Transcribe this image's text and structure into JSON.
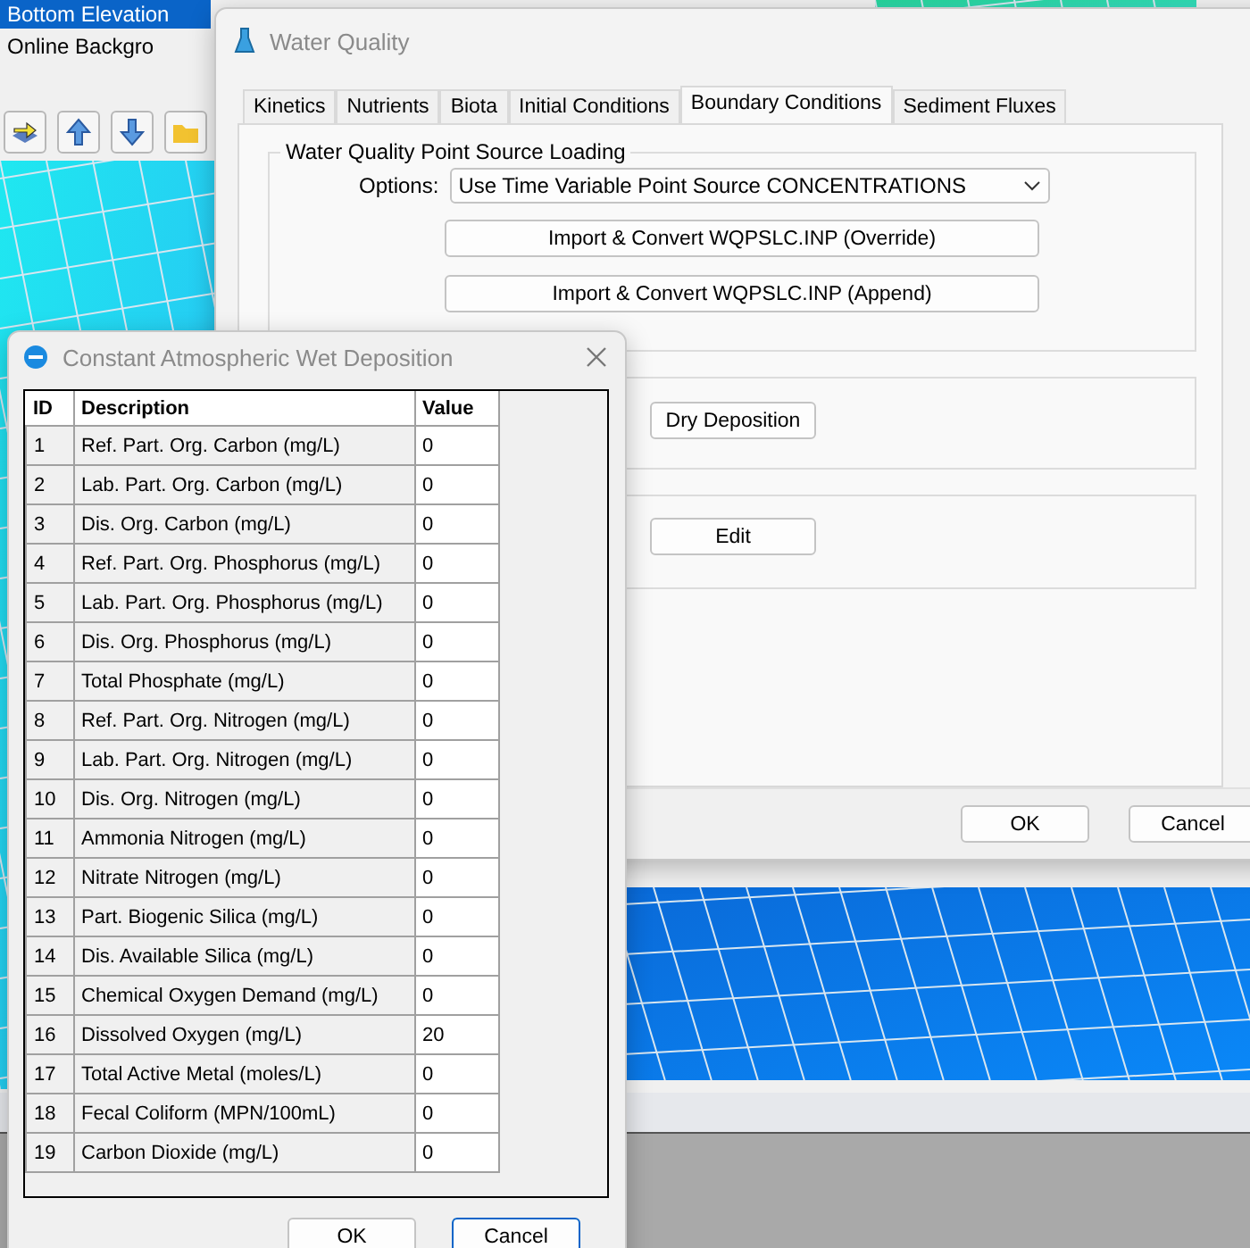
{
  "background_app": {
    "layers": [
      {
        "label": "Bottom Elevation",
        "selected": true
      },
      {
        "label": "Online Backgro",
        "selected": false
      }
    ]
  },
  "water_quality": {
    "title": "Water Quality",
    "tabs": [
      {
        "label": "Kinetics",
        "selected": false
      },
      {
        "label": "Nutrients",
        "selected": false
      },
      {
        "label": "Biota",
        "selected": false
      },
      {
        "label": "Initial Conditions",
        "selected": false
      },
      {
        "label": "Boundary Conditions",
        "selected": true
      },
      {
        "label": "Sediment Fluxes",
        "selected": false
      }
    ],
    "point_source": {
      "legend": "Water Quality Point Source Loading",
      "options_label": "Options:",
      "option_value": "Use Time Variable Point Source CONCENTRATIONS",
      "buttons": [
        "Import & Convert WQPSLC.INP (Override)",
        "Import & Convert WQPSLC.INP (Append)"
      ]
    },
    "dry_deposition_button": "Dry Deposition",
    "edit_button": "Edit",
    "buttons": [
      {
        "label": "OK",
        "focused": false
      },
      {
        "label": "Cancel",
        "focused": false
      }
    ]
  },
  "wet_deposition": {
    "title": "Constant Atmospheric Wet Deposition",
    "columns": [
      "ID",
      "Description",
      "Value"
    ],
    "rows": [
      {
        "id": "1",
        "description": "Ref. Part. Org. Carbon (mg/L)",
        "value": "0"
      },
      {
        "id": "2",
        "description": "Lab. Part. Org. Carbon (mg/L)",
        "value": "0"
      },
      {
        "id": "3",
        "description": "Dis. Org. Carbon (mg/L)",
        "value": "0"
      },
      {
        "id": "4",
        "description": "Ref. Part. Org. Phosphorus (mg/L)",
        "value": "0"
      },
      {
        "id": "5",
        "description": "Lab. Part. Org. Phosphorus (mg/L)",
        "value": "0"
      },
      {
        "id": "6",
        "description": "Dis. Org. Phosphorus (mg/L)",
        "value": "0"
      },
      {
        "id": "7",
        "description": "Total Phosphate (mg/L)",
        "value": "0"
      },
      {
        "id": "8",
        "description": "Ref. Part. Org. Nitrogen (mg/L)",
        "value": "0"
      },
      {
        "id": "9",
        "description": "Lab. Part. Org. Nitrogen (mg/L)",
        "value": "0"
      },
      {
        "id": "10",
        "description": "Dis. Org. Nitrogen (mg/L)",
        "value": "0"
      },
      {
        "id": "11",
        "description": "Ammonia Nitrogen (mg/L)",
        "value": "0"
      },
      {
        "id": "12",
        "description": "Nitrate Nitrogen (mg/L)",
        "value": "0"
      },
      {
        "id": "13",
        "description": "Part. Biogenic Silica (mg/L)",
        "value": "0"
      },
      {
        "id": "14",
        "description": "Dis. Available Silica (mg/L)",
        "value": "0"
      },
      {
        "id": "15",
        "description": "Chemical Oxygen Demand (mg/L)",
        "value": "0"
      },
      {
        "id": "16",
        "description": "Dissolved Oxygen (mg/L)",
        "value": "20"
      },
      {
        "id": "17",
        "description": "Total Active Metal (moles/L)",
        "value": "0"
      },
      {
        "id": "18",
        "description": "Fecal Coliform (MPN/100mL)",
        "value": "0"
      },
      {
        "id": "19",
        "description": "Carbon Dioxide (mg/L)",
        "value": "0"
      }
    ],
    "buttons": [
      {
        "label": "OK",
        "focused": false
      },
      {
        "label": "Cancel",
        "focused": true
      }
    ]
  }
}
